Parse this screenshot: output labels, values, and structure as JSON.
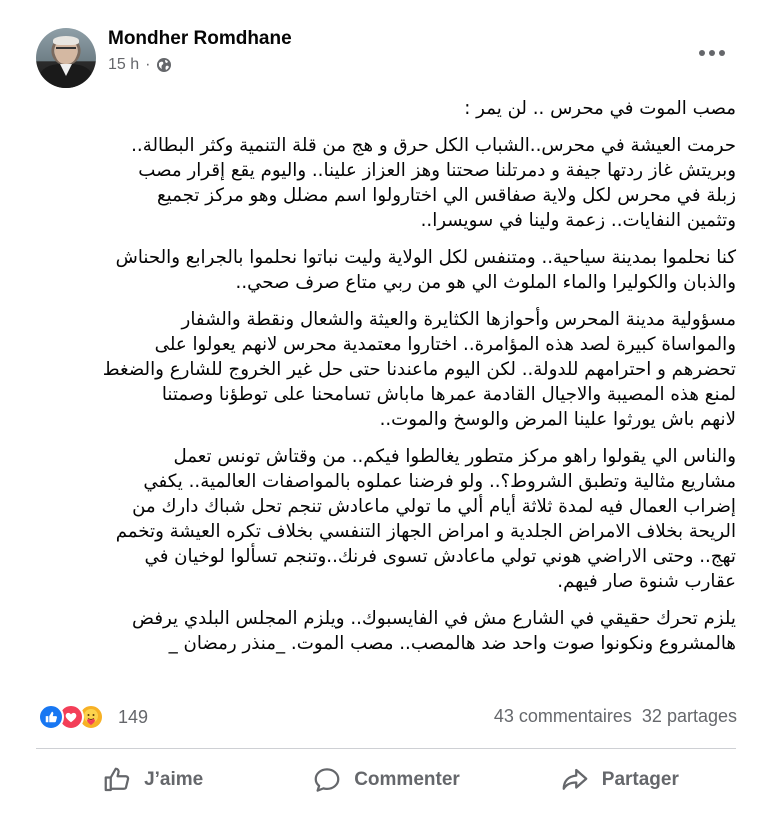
{
  "post": {
    "author": "Mondher Romdhane",
    "time": "15 h",
    "separator": "·",
    "privacy_icon": "globe-icon",
    "paragraphs": [
      "مصب الموت في محرس .. لن يمر :",
      "حرمت العيشة في محرس..الشباب الكل حرق و هج من قلة التنمية وكثر البطالة..\nوبريتش غاز ردتها جيفة و دمرتلنا صحتنا وهز العزاز علينا.. واليوم يقع إقرار مصب\nزبلة في محرس لكل ولاية صفاقس الي اختارولوا اسم مضلل وهو مركز تجميع\nوتثمين النفايات.. زعمة ولينا في سويسرا..",
      "كنا نحلموا بمدينة سياحية.. ومتنفس لكل الولاية وليت نباتوا نحلموا بالجرابع والحناش\nوالذبان والكوليرا والماء الملوث الي هو من ربي متاع صرف صحي..",
      "مسؤولية مدينة المحرس وأحوازها الكثايرة والعيثة والشعال ونقطة والشفار\nوالمواساة كبيرة لصد هذه المؤامرة.. اختاروا معتمدية محرس لانهم يعولوا على\nتحضرهم و احترامهم للدولة.. لكن اليوم ماعندنا حتى حل غير الخروج للشارع والضغط\nلمنع هذه المصيبة والاجيال القادمة عمرها ماباش تسامحنا على توطؤنا وصمتنا\nلانهم باش يورثوا علينا المرض والوسخ والموت..",
      "والناس الي يقولوا راهو مركز متطور يغالطوا فيكم.. من وقتاش تونس تعمل\nمشاريع مثالية وتطبق الشروط؟.. ولو فرضنا عملوه بالمواصفات العالمية.. يكفي\nإضراب العمال فيه لمدة ثلاثة أيام ألي ما تولي ماعادش تنجم تحل شباك دارك من\nالريحة بخلاف الامراض الجلدية و امراض الجهاز التنفسي بخلاف تكره العيشة وتخمم\nتهج.. وحتى الاراضي هوني تولي ماعادش تسوى فرنك..وتنجم تسألوا لوخيان في\nعقارب شنوة صار فيهم.",
      "يلزم تحرك حقيقي في الشارع مش في الفايسبوك.. ويلزم المجلس البلدي يرفض\nهالمشروع ونكونوا صوت واحد ضد هالمصب.. مصب الموت. _منذر رمضان _"
    ]
  },
  "reactions": {
    "icons": [
      "like-icon",
      "love-icon",
      "care-icon"
    ],
    "colors": {
      "like": "#1877f2",
      "love": "#f33e58",
      "care": "#f7b125"
    },
    "count": "149"
  },
  "stats": {
    "comments": "43 commentaires",
    "shares": "32 partages"
  },
  "actions": {
    "like_label": "J’aime",
    "comment_label": "Commenter",
    "share_label": "Partager"
  }
}
